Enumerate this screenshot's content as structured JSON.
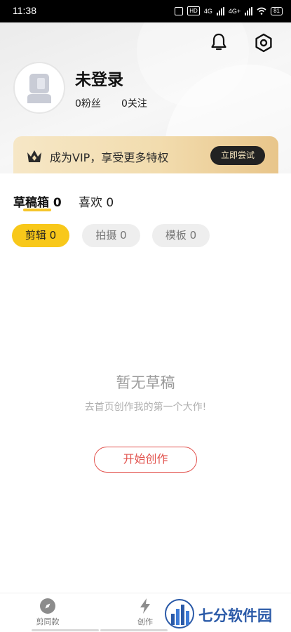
{
  "status_bar": {
    "time": "11:38",
    "network_badge": "HD",
    "network_1": "4G",
    "network_2": "4G+",
    "battery": "81"
  },
  "header": {
    "username": "未登录",
    "fans": "0粉丝",
    "following": "0关注",
    "icons": [
      "bell-icon",
      "settings-icon"
    ]
  },
  "vip": {
    "text": "成为VIP，享受更多特权",
    "button": "立即尝试"
  },
  "tabs": [
    {
      "label": "草稿箱 0",
      "active": true
    },
    {
      "label": "喜欢 0",
      "active": false
    }
  ],
  "chips": [
    {
      "label": "剪辑 0",
      "active": true
    },
    {
      "label": "拍摄 0",
      "active": false
    },
    {
      "label": "模板 0",
      "active": false
    }
  ],
  "empty_state": {
    "title": "暂无草稿",
    "subtitle": "去首页创作我的第一个大作!",
    "button": "开始创作"
  },
  "bottom_nav": [
    {
      "label": "剪同款",
      "icon": "compass-icon"
    },
    {
      "label": "创作",
      "icon": "lightning-icon"
    }
  ],
  "watermark": {
    "text": "七分软件园"
  },
  "colors": {
    "accent_yellow": "#f8c81a",
    "create_red": "#e2534e",
    "vip_gold": "#f2dcae",
    "watermark_blue": "#2b5aa8"
  }
}
